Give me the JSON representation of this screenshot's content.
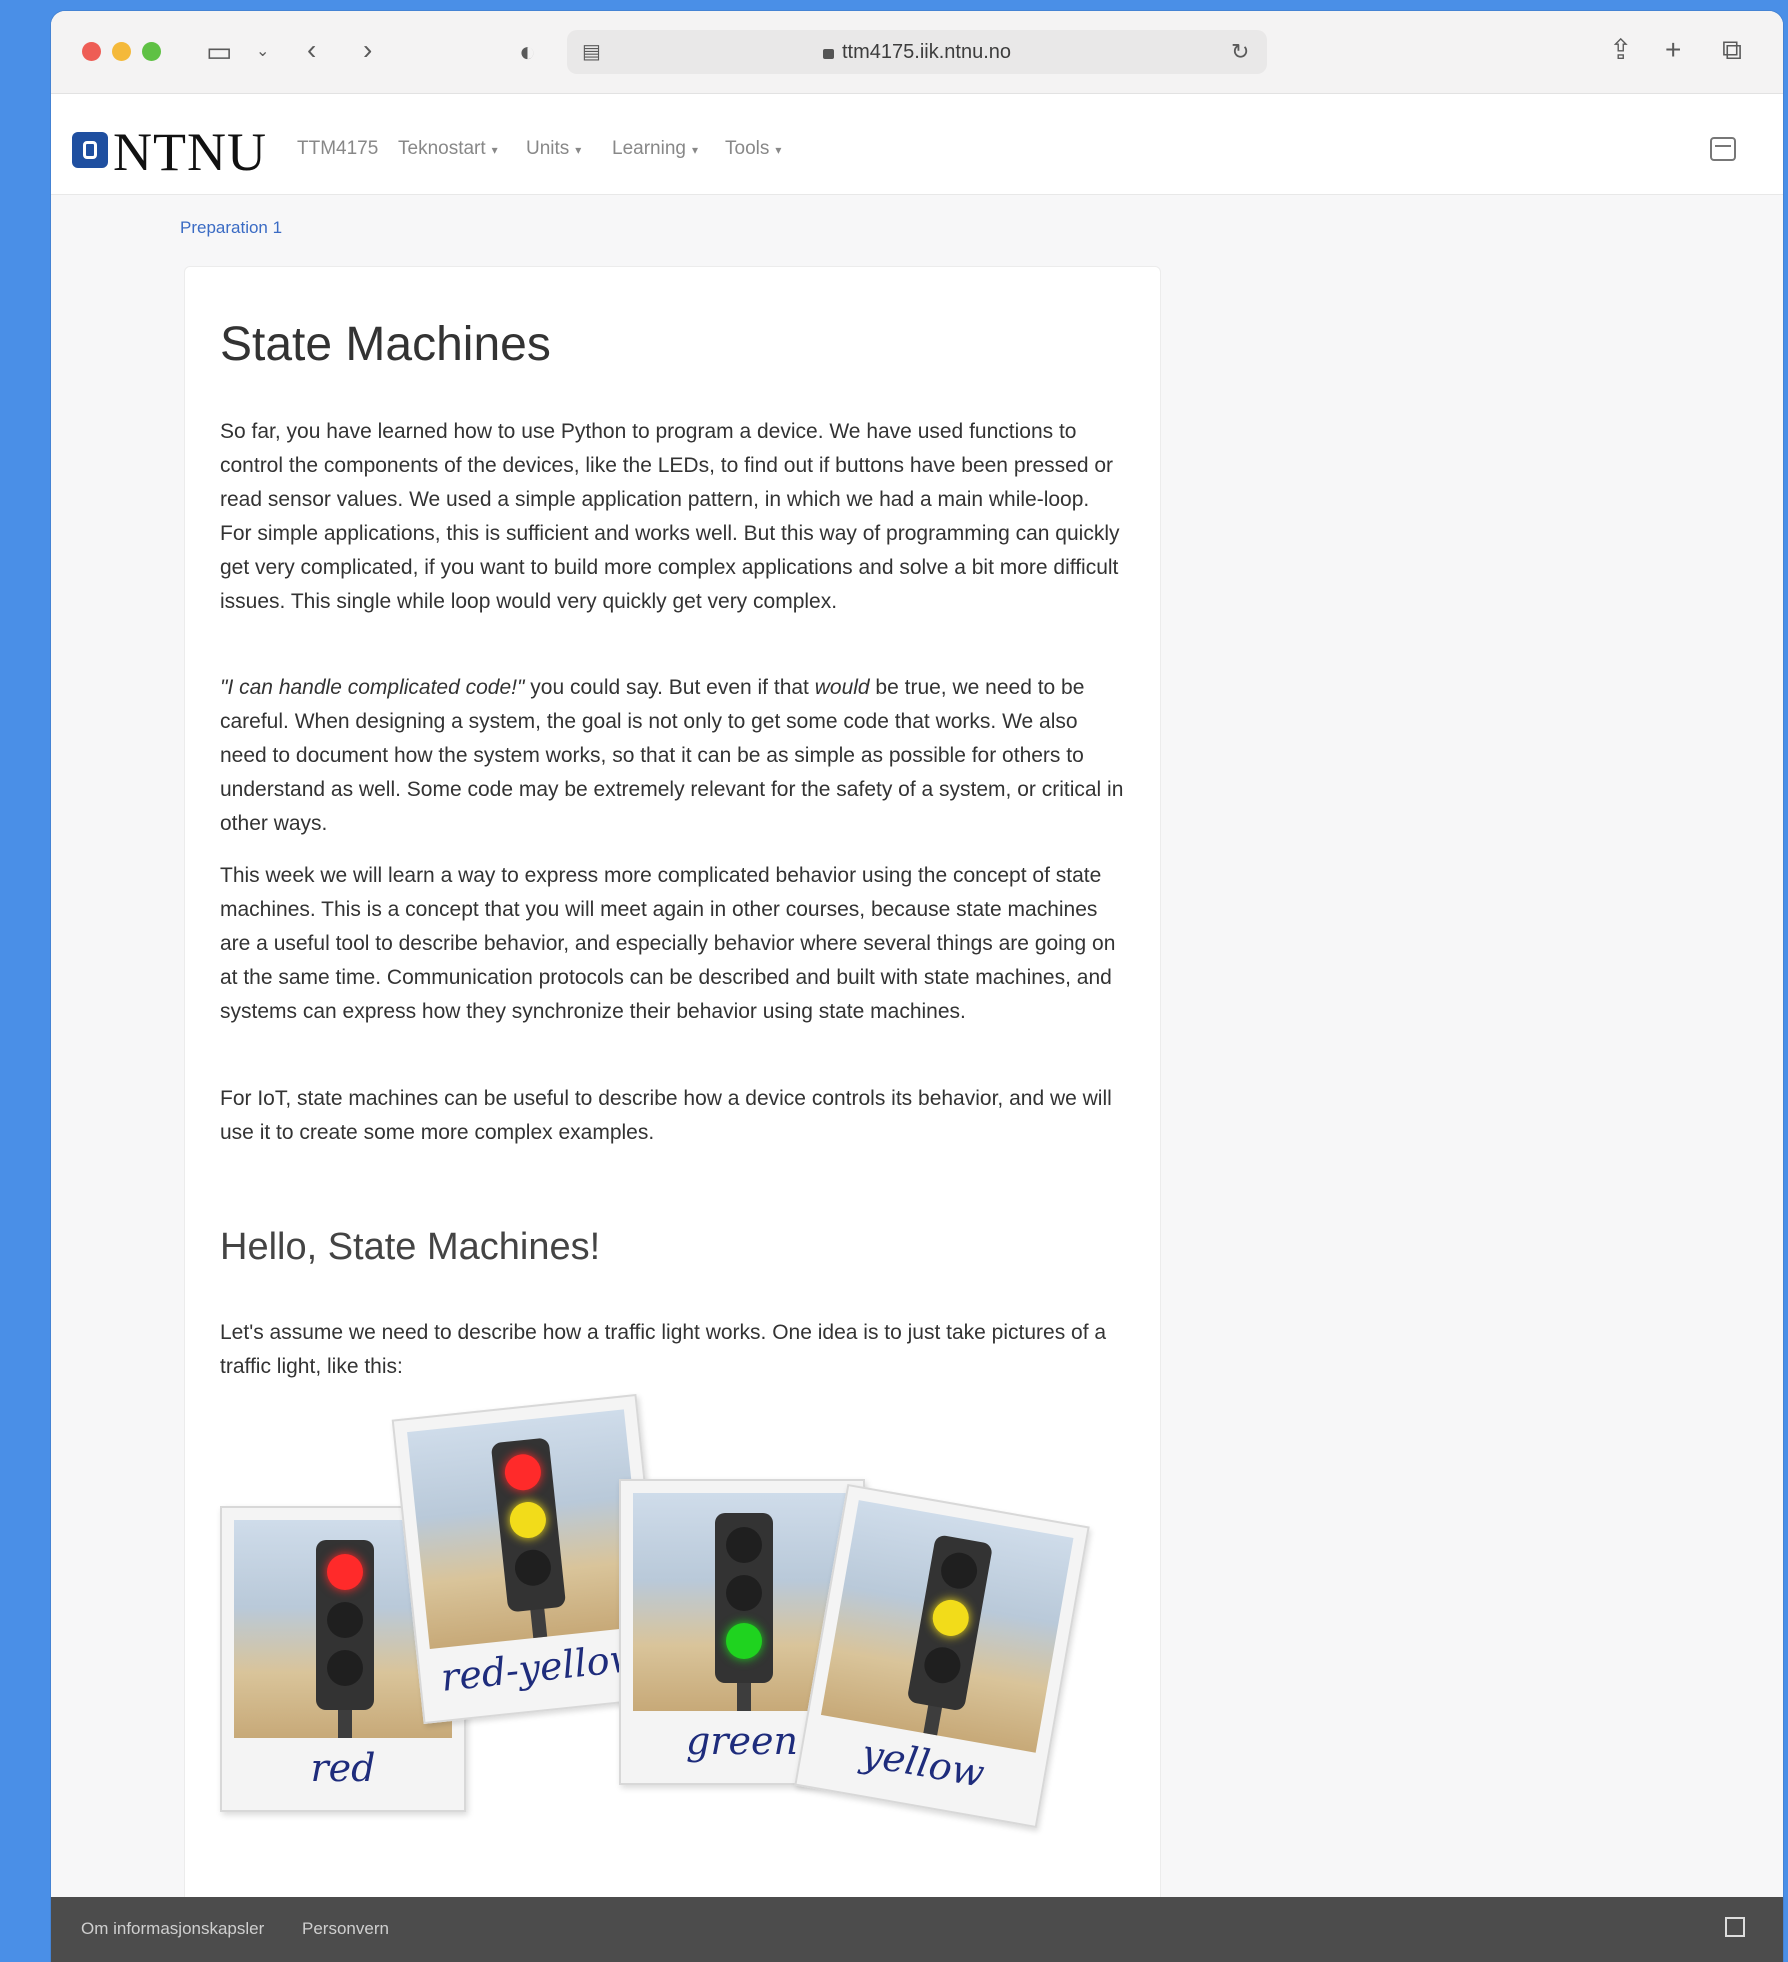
{
  "browser": {
    "url": "ttm4175.iik.ntnu.no"
  },
  "nav": {
    "logo": "NTNU",
    "items": [
      {
        "label": "TTM4175",
        "dropdown": false
      },
      {
        "label": "Teknostart",
        "dropdown": true
      },
      {
        "label": "Units",
        "dropdown": true
      },
      {
        "label": "Learning",
        "dropdown": true
      },
      {
        "label": "Tools",
        "dropdown": true
      }
    ]
  },
  "breadcrumb": "Preparation 1",
  "article": {
    "title": "State Machines",
    "p1": "So far, you have learned how to use Python to program a device. We have used functions to control the components of the devices, like the LEDs, to find out if buttons have been pressed or read sensor values. We used a simple application pattern, in which we had a main while-loop. For simple applications, this is sufficient and works well. But this way of programming can quickly get very complicated, if you want to build more complex applications and solve a bit more difficult issues. This single while loop would very quickly get very complex.",
    "p2_italic": "\"I can handle complicated code!\"",
    "p2_a": " you could say. But even if that ",
    "p2_would": "would",
    "p2_b": " be true, we need to be careful. When designing a system, the goal is not only to get some code that works. We also need to document how the system works, so that it can be as simple as possible for others to understand as well. Some code may be extremely relevant for the safety of a system, or critical in other ways.",
    "p3": "This week we will learn a way to express more complicated behavior using the concept of state machines. This is a concept that you will meet again in other courses, because state machines are a useful tool to describe behavior, and especially behavior where several things are going on at the same time. Communication protocols can be described and built with state machines, and systems can express how they synchronize their behavior using state machines.",
    "p4": "For IoT, state machines can be useful to describe how a device controls its behavior, and we will use it to create some more complex examples.",
    "subtitle": "Hello, State Machines!",
    "p5": "Let's assume we need to describe how a traffic light works. One idea is to just take pictures of a traffic light, like this:"
  },
  "photos": [
    {
      "caption": "red",
      "lit": [
        "#ff2a2a",
        null,
        null
      ]
    },
    {
      "caption": "red-yellow",
      "lit": [
        "#ff2a2a",
        "#f2dc1a",
        null
      ]
    },
    {
      "caption": "green",
      "lit": [
        null,
        null,
        "#1fd31f"
      ]
    },
    {
      "caption": "yellow",
      "lit": [
        null,
        "#f2dc1a",
        null
      ]
    }
  ],
  "footer": {
    "link1": "Om informasjonskapsler",
    "link2": "Personvern"
  }
}
